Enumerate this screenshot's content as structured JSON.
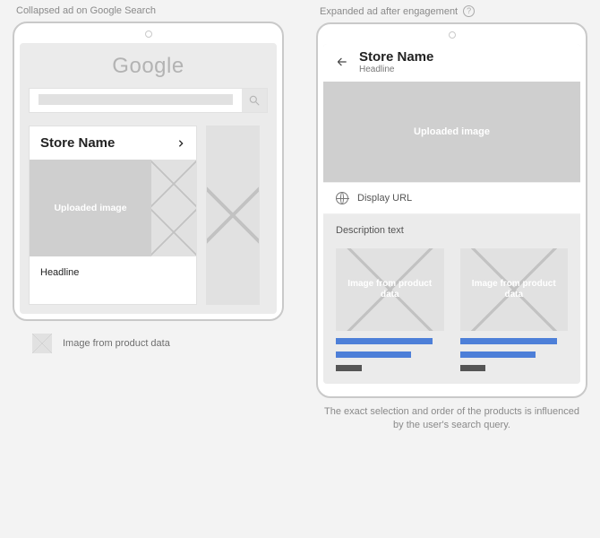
{
  "left": {
    "caption": "Collapsed ad on Google Search",
    "logo": "Google",
    "store_name": "Store Name",
    "uploaded_image_label": "Uploaded image",
    "headline": "Headline"
  },
  "right": {
    "caption": "Expanded ad after engagement",
    "store_name": "Store Name",
    "headline": "Headline",
    "uploaded_image_label": "Uploaded image",
    "display_url_label": "Display URL",
    "description_label": "Description text",
    "product_image_label": "Image from product data",
    "footnote": "The exact selection and order of the products is influenced by the user's search query."
  },
  "legend": {
    "label": "Image from product data"
  }
}
